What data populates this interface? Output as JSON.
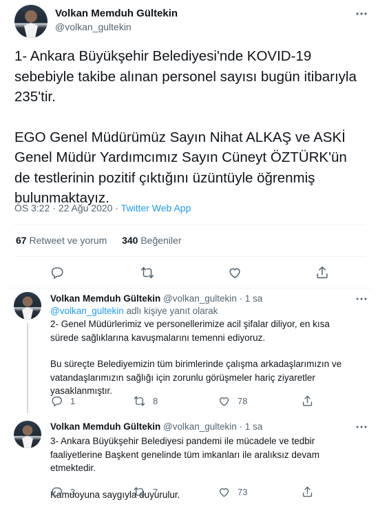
{
  "main": {
    "name": "Volkan Memduh Gültekin",
    "handle": "@volkan_gultekin",
    "text_p1": "1- Ankara Büyükşehir Belediyesi'nde KOVID-19 sebebiyle takibe alınan personel sayısı bugün itibarıyla 235'tir.",
    "text_p2": "EGO Genel Müdürümüz Sayın Nihat ALKAŞ ve ASKİ Genel Müdür Yardımcımız Sayın Cüneyt ÖZTÜRK'ün de testlerinin pozitif çıktığını üzüntüyle öğrenmiş bulunmaktayız.",
    "time": "ÖS 3:22",
    "date": "22 Ağu 2020",
    "separator": " · ",
    "source": "Twitter Web App",
    "retweets_count": "67",
    "retweets_label": "Retweet ve yorum",
    "likes_count": "340",
    "likes_label": "Beğeniler"
  },
  "replies": [
    {
      "name": "Volkan Memduh Gültekin",
      "handle_time": "@volkan_gultekin · 1 sa",
      "reply_to_handle": "@volkan_gultekin",
      "reply_to_suffix": " adlı kişiye yanıt olarak",
      "p1": "2- Genel Müdürlerimiz ve personellerimize acil şifalar diliyor, en kısa sürede sağlıklarına kavuşmalarını temenni ediyoruz.",
      "p2": "Bu süreçte Belediyemizin tüm birimlerinde çalışma arkadaşlarımızın ve vatandaşlarımızın sağlığı için zorunlu görüşmeler hariç ziyaretler yasaklanmıştır.",
      "replies": "1",
      "retweets": "8",
      "likes": "78"
    },
    {
      "name": "Volkan Memduh Gültekin",
      "handle_time": "@volkan_gultekin · 1 sa",
      "p1": "3- Ankara Büyükşehir Belediyesi pandemi ile mücadele ve tedbir faaliyetlerine Başkent genelinde tüm imkanları ile aralıksız devam etmektedir.",
      "p2": "Kamuoyuna saygıyla duyurulur.",
      "replies": "3",
      "retweets": "7",
      "likes": "73"
    }
  ],
  "icons": {
    "reply": "reply-icon",
    "retweet": "retweet-icon",
    "like": "heart-icon",
    "share": "share-icon",
    "more": "more-icon"
  },
  "colors": {
    "link": "#1d9bf0",
    "secondary_text": "#536471",
    "primary_text": "#0f1419"
  }
}
